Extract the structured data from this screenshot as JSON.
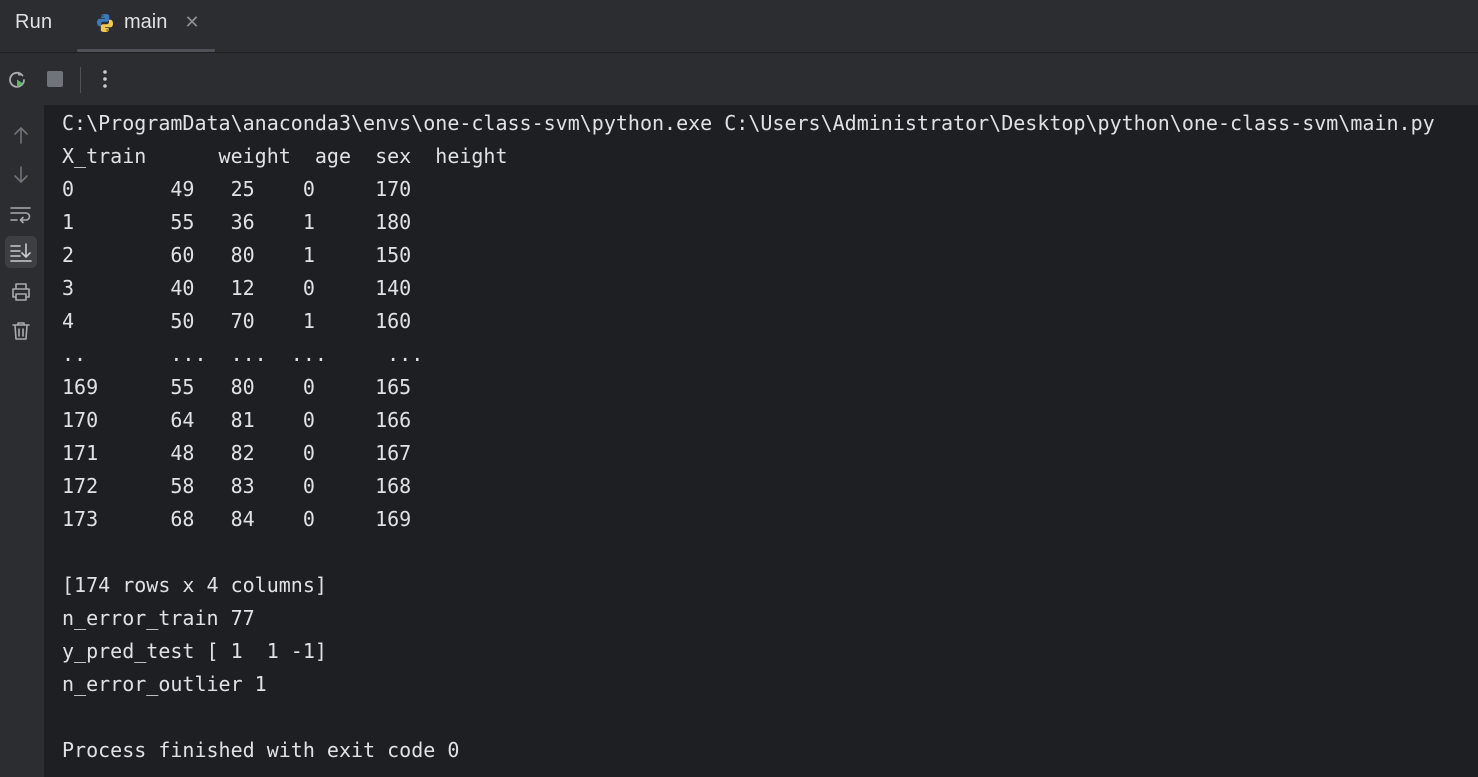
{
  "header": {
    "title": "Run",
    "tab": {
      "label": "main",
      "icon": "python-icon",
      "close_icon": "close-icon",
      "close_glyph": "✕"
    }
  },
  "toolbar": {
    "buttons": [
      "rerun-icon",
      "stop-icon",
      "more-options-icon"
    ]
  },
  "gutter": {
    "buttons": [
      "up-arrow-icon",
      "down-arrow-icon",
      "soft-wrap-icon",
      "scroll-to-end-icon",
      "print-icon",
      "trash-icon"
    ],
    "active": "scroll-to-end-icon"
  },
  "console": {
    "lines": [
      "C:\\ProgramData\\anaconda3\\envs\\one-class-svm\\python.exe C:\\Users\\Administrator\\Desktop\\python\\one-class-svm\\main.py",
      "X_train      weight  age  sex  height",
      "0        49   25    0     170",
      "1        55   36    1     180",
      "2        60   80    1     150",
      "3        40   12    0     140",
      "4        50   70    1     160",
      "..       ...  ...  ...     ...",
      "169      55   80    0     165",
      "170      64   81    0     166",
      "171      48   82    0     167",
      "172      58   83    0     168",
      "173      68   84    0     169",
      "",
      "[174 rows x 4 columns]",
      "n_error_train 77",
      "y_pred_test [ 1  1 -1]",
      "n_error_outlier 1",
      "",
      "Process finished with exit code 0"
    ]
  },
  "colors": {
    "background": "#1e1f22",
    "panel": "#2b2d30",
    "text": "#dfe1e5",
    "icon": "#a8abb0",
    "rerun_accent": "#5fb865",
    "python_blue": "#3d7ab8",
    "python_yellow": "#f2c94c"
  }
}
